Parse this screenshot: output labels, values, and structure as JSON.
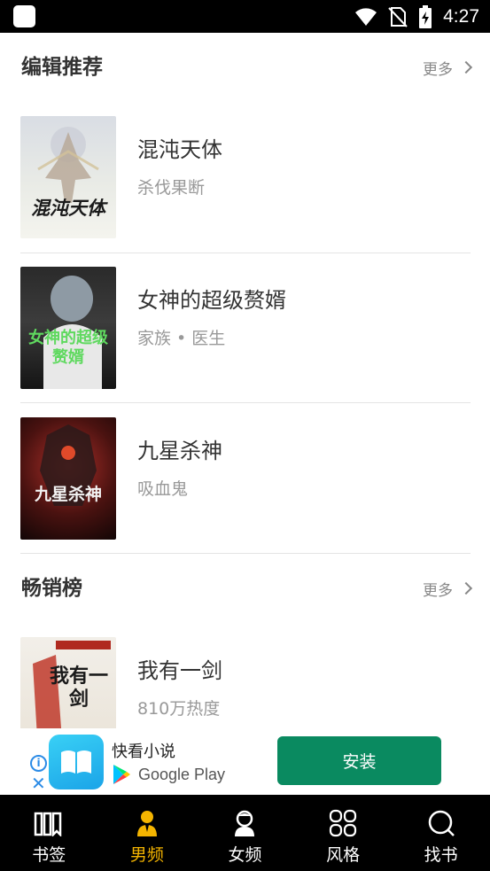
{
  "status_bar": {
    "time": "4:27"
  },
  "sections": [
    {
      "title": "编辑推荐",
      "more_label": "更多",
      "books": [
        {
          "title": "混沌天体",
          "subtitle": "杀伐果断",
          "cover_text": "混沌天体"
        },
        {
          "title": "女神的超级赘婿",
          "subtitle": "家族 • 医生",
          "cover_text": "女神的超级赘婿"
        },
        {
          "title": "九星杀神",
          "subtitle": "吸血鬼",
          "cover_text": "九星杀神"
        }
      ]
    },
    {
      "title": "畅销榜",
      "more_label": "更多",
      "books": [
        {
          "title": "我有一剑",
          "subtitle": "810万热度",
          "cover_text": "我有一剑"
        }
      ]
    }
  ],
  "ad": {
    "app_name": "快看小说",
    "store_name": "Google Play",
    "install_label": "安装"
  },
  "bottom_nav": [
    {
      "label": "书签",
      "icon": "bookmark-icon",
      "active": false
    },
    {
      "label": "男频",
      "icon": "male-icon",
      "active": true
    },
    {
      "label": "女频",
      "icon": "female-icon",
      "active": false
    },
    {
      "label": "风格",
      "icon": "grid-icon",
      "active": false
    },
    {
      "label": "找书",
      "icon": "search-icon",
      "active": false
    }
  ],
  "colors": {
    "accent": "#f4b400",
    "install_button": "#0a8a60",
    "nav_background": "#000000"
  }
}
